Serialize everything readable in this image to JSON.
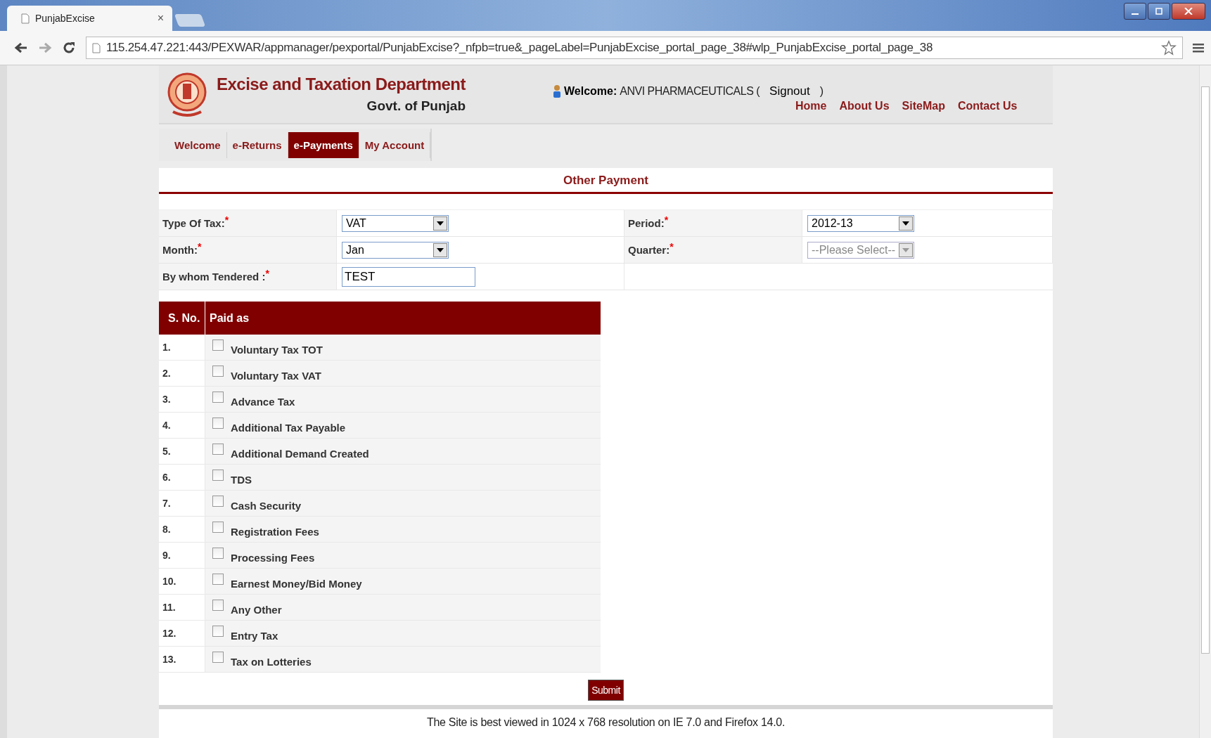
{
  "browser": {
    "tab_title": "PunjabExcise",
    "address": "115.254.47.221:443/PEXWAR/appmanager/pexportal/PunjabExcise?_nfpb=true&_pageLabel=PunjabExcise_portal_page_38#wlp_PunjabExcise_portal_page_38",
    "tab_close": "×"
  },
  "header": {
    "title": "Excise and Taxation Department",
    "subtitle": "Govt. of Punjab",
    "welcome_label": "Welcome:",
    "user": "ANVI PHARMACEUTICALS (",
    "signout": "Signout",
    "close_paren": ")",
    "links": [
      "Home",
      "About Us",
      "SiteMap",
      "Contact Us"
    ]
  },
  "tabs": [
    {
      "label": "Welcome",
      "selected": false
    },
    {
      "label": "e-Returns",
      "selected": false
    },
    {
      "label": "e-Payments",
      "selected": true
    },
    {
      "label": "My Account",
      "selected": false
    }
  ],
  "section_title": "Other Payment",
  "form": {
    "type_of_tax": {
      "label": "Type Of Tax:",
      "value": "VAT"
    },
    "period": {
      "label": "Period:",
      "value": "2012-13"
    },
    "month": {
      "label": "Month:",
      "value": "Jan"
    },
    "quarter": {
      "label": "Quarter:",
      "value": "--Please Select--",
      "disabled": true
    },
    "tendered": {
      "label": "By whom Tendered :",
      "value": "TEST"
    },
    "required_mark": "*"
  },
  "table": {
    "columns": [
      "S. No.",
      "Paid as"
    ],
    "rows": [
      {
        "sno": "1.",
        "label": "Voluntary Tax TOT",
        "checked": false
      },
      {
        "sno": "2.",
        "label": "Voluntary Tax VAT",
        "checked": false
      },
      {
        "sno": "3.",
        "label": "Advance Tax",
        "checked": false
      },
      {
        "sno": "4.",
        "label": "Additional Tax Payable",
        "checked": false
      },
      {
        "sno": "5.",
        "label": "Additional Demand Created",
        "checked": false
      },
      {
        "sno": "6.",
        "label": "TDS",
        "checked": false
      },
      {
        "sno": "7.",
        "label": "Cash Security",
        "checked": false
      },
      {
        "sno": "8.",
        "label": "Registration Fees",
        "checked": false
      },
      {
        "sno": "9.",
        "label": "Processing Fees",
        "checked": false
      },
      {
        "sno": "10.",
        "label": "Earnest Money/Bid Money",
        "checked": false
      },
      {
        "sno": "11.",
        "label": "Any Other",
        "checked": false
      },
      {
        "sno": "12.",
        "label": "Entry Tax",
        "checked": false
      },
      {
        "sno": "13.",
        "label": "Tax on Lotteries",
        "checked": false
      }
    ]
  },
  "submit": "Submit",
  "footer": "The Site is best viewed in 1024 x 768 resolution on IE 7.0 and Firefox 14.0."
}
